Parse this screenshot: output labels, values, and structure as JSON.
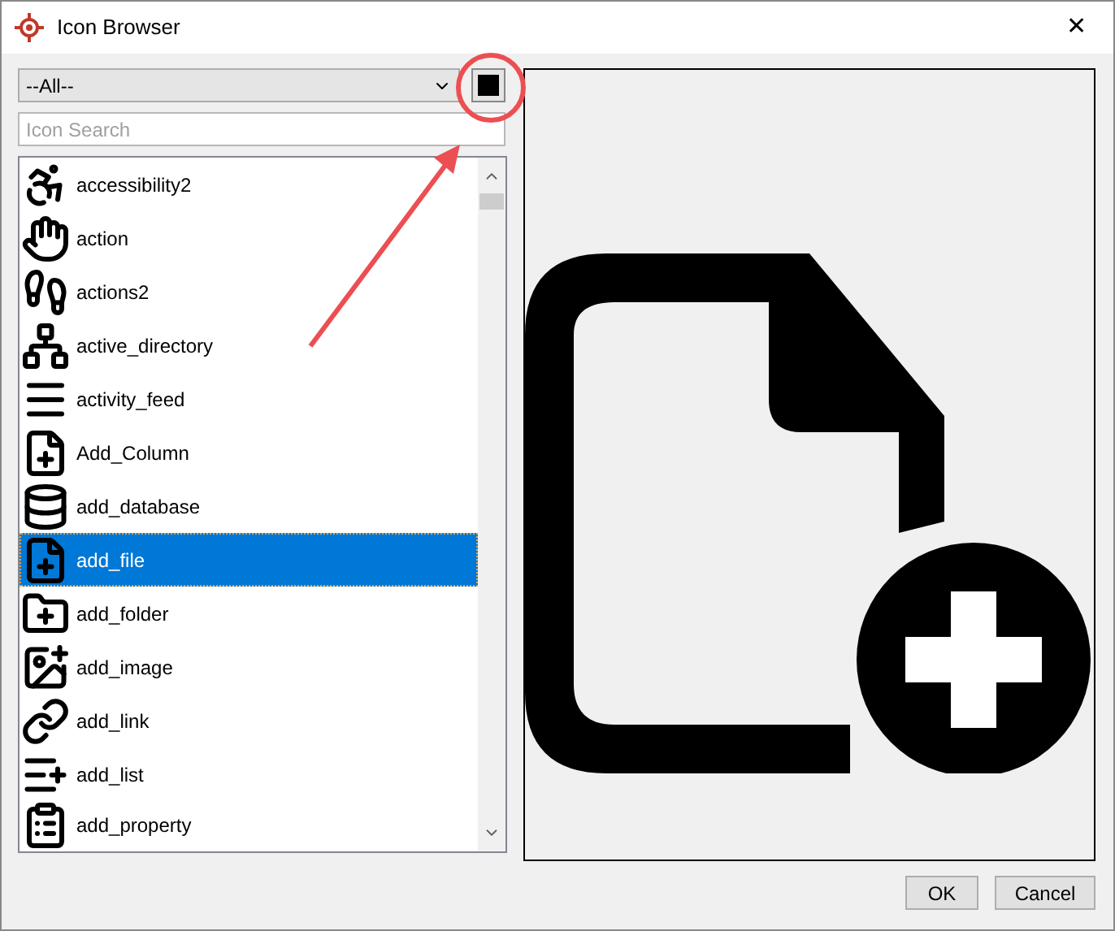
{
  "window": {
    "title": "Icon Browser",
    "close": "✕"
  },
  "category_select": {
    "value": "--All--"
  },
  "color_swatch": {
    "color": "#000000"
  },
  "search": {
    "placeholder": "Icon Search"
  },
  "icons": [
    {
      "label": "accessibility2",
      "selected": false
    },
    {
      "label": "action",
      "selected": false
    },
    {
      "label": "actions2",
      "selected": false
    },
    {
      "label": "active_directory",
      "selected": false
    },
    {
      "label": "activity_feed",
      "selected": false
    },
    {
      "label": "Add_Column",
      "selected": false
    },
    {
      "label": "add_database",
      "selected": false
    },
    {
      "label": "add_file",
      "selected": true
    },
    {
      "label": "add_folder",
      "selected": false
    },
    {
      "label": "add_image",
      "selected": false
    },
    {
      "label": "add_link",
      "selected": false
    },
    {
      "label": "add_list",
      "selected": false
    },
    {
      "label": "add_property",
      "selected": false
    }
  ],
  "annotations": [
    {
      "kind": "circle"
    },
    {
      "kind": "arrow"
    }
  ],
  "buttons": [
    "OK",
    "Cancel"
  ]
}
